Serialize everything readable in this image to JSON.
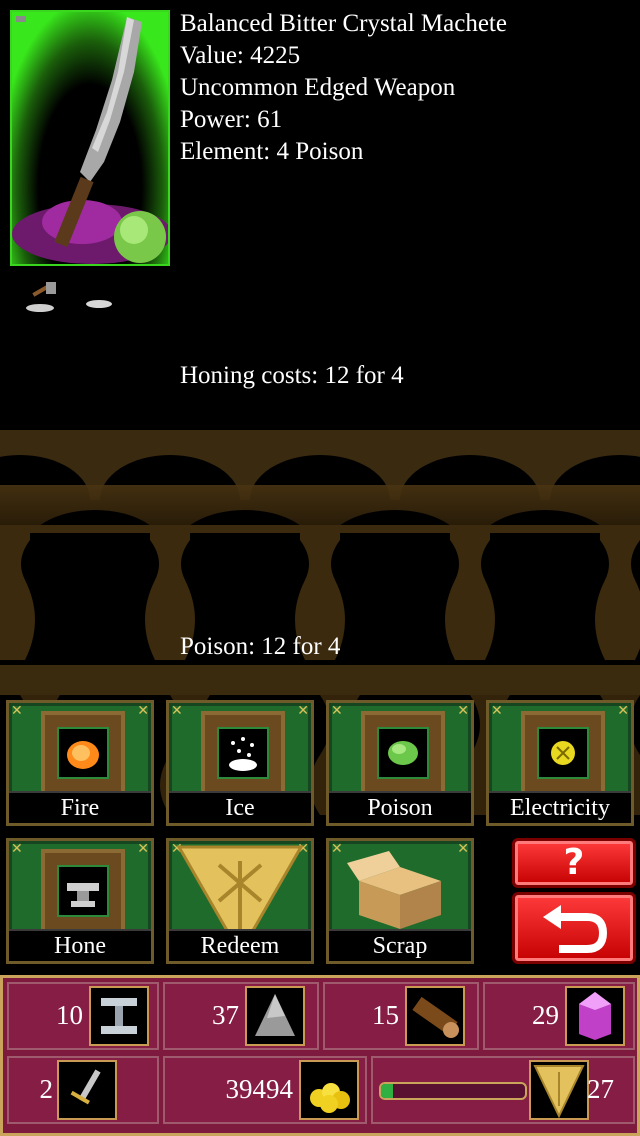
{
  "item": {
    "name": "Balanced Bitter Crystal Machete",
    "value_line": "Value: 4225",
    "rarity_line": "Uncommon Edged Weapon",
    "power_line": "Power: 61",
    "element_line": "Element: 4 Poison",
    "icons": [
      "machete-icon",
      "hatchet-icon",
      "anvil-slot-icon"
    ]
  },
  "costs": {
    "honing": "Honing costs: 12 for 4",
    "element": "Poison: 12 for 4"
  },
  "actions": [
    {
      "label": "Fire",
      "icon": "fire-icon"
    },
    {
      "label": "Ice",
      "icon": "ice-icon"
    },
    {
      "label": "Poison",
      "icon": "poison-icon"
    },
    {
      "label": "Electricity",
      "icon": "electricity-icon"
    },
    {
      "label": "Hone",
      "icon": "anvil-icon"
    },
    {
      "label": "Redeem",
      "icon": "token-icon"
    },
    {
      "label": "Scrap",
      "icon": "box-icon"
    }
  ],
  "side_buttons": {
    "help": "?",
    "back_icon": "back-arrow-icon"
  },
  "resources": {
    "steel": "10",
    "stone": "37",
    "wood": "15",
    "crystal": "29",
    "swords": "2",
    "gold": "39494",
    "tokens": "27",
    "progress": 0.08
  },
  "colors": {
    "action_green": "#1f6b2c",
    "panel_red": "#7e1a3e",
    "border_gold": "#caa45b",
    "red_button": "#e01010",
    "portrait_glow": "#39e81c"
  }
}
